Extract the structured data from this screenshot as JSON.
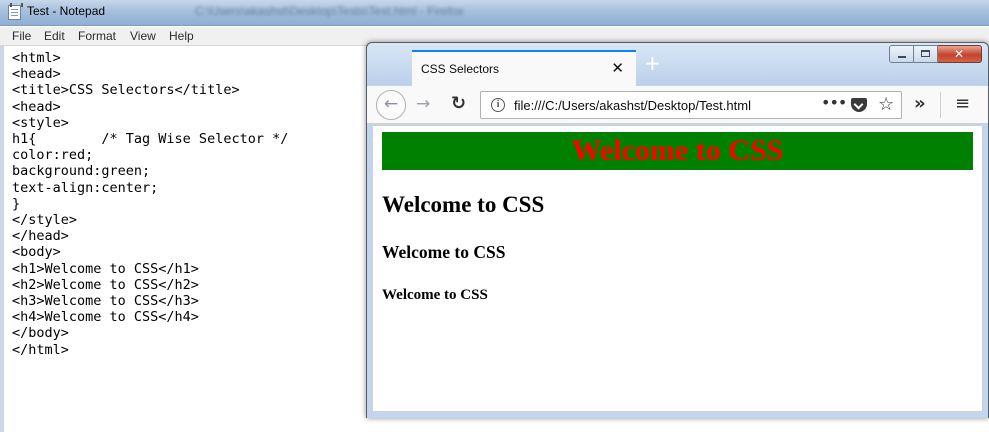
{
  "notepad": {
    "title": "Test - Notepad",
    "blurred_path": "C:\\Users\\akashst\\Desktop\\Tests\\Test.html - Firefox",
    "menu": [
      "File",
      "Edit",
      "Format",
      "View",
      "Help"
    ],
    "code": "<html>\n<head>\n<title>CSS Selectors</title>\n<head>\n<style>\nh1{        /* Tag Wise Selector */\ncolor:red;\nbackground:green;\ntext-align:center;\n}\n</style>\n</head>\n<body>\n<h1>Welcome to CSS</h1>\n<h2>Welcome to CSS</h2>\n<h3>Welcome to CSS</h3>\n<h4>Welcome to CSS</h4>\n</body>\n</html>"
  },
  "browser": {
    "tab_title": "CSS Selectors",
    "tab_close": "✕",
    "new_tab": "+",
    "url": "file:///C:/Users/akashst/Desktop/Test.html",
    "page_actions": "•••",
    "window_close": "✕",
    "icons": {
      "back": "arrow-left",
      "forward": "arrow-right",
      "reload": "reload",
      "info": "info",
      "pocket": "pocket",
      "bookmark": "star",
      "overflow": "chevrons-right",
      "menu": "hamburger"
    },
    "page": {
      "h1": "Welcome to CSS",
      "h2": "Welcome to CSS",
      "h3": "Welcome to CSS",
      "h4": "Welcome to CSS",
      "h1_color": "#ff0000",
      "h1_background": "#008000"
    }
  }
}
